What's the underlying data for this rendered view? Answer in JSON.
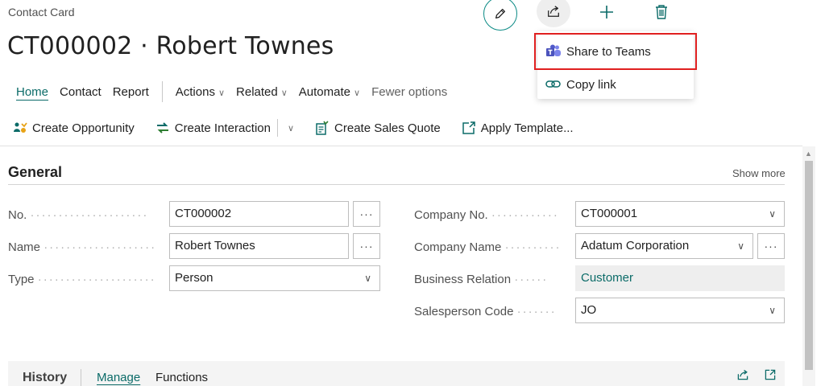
{
  "header": {
    "breadcrumb": "Contact Card",
    "title": "CT000002 · Robert Townes"
  },
  "share_menu": {
    "items": [
      {
        "label": "Share to Teams",
        "icon": "teams-icon"
      },
      {
        "label": "Copy link",
        "icon": "link-icon"
      }
    ]
  },
  "nav": {
    "tabs": [
      {
        "label": "Home",
        "active": true
      },
      {
        "label": "Contact"
      },
      {
        "label": "Report"
      }
    ],
    "menus": [
      {
        "label": "Actions"
      },
      {
        "label": "Related"
      },
      {
        "label": "Automate"
      }
    ],
    "fewer_label": "Fewer options"
  },
  "actions": {
    "create_opportunity": "Create Opportunity",
    "create_interaction": "Create Interaction",
    "create_sales_quote": "Create Sales Quote",
    "apply_template": "Apply Template..."
  },
  "general": {
    "title": "General",
    "show_more": "Show more",
    "left_fields": [
      {
        "label": "No.",
        "value": "CT000002"
      },
      {
        "label": "Name",
        "value": "Robert Townes"
      },
      {
        "label": "Type",
        "value": "Person"
      }
    ],
    "right_fields": [
      {
        "label": "Company No.",
        "value": "CT000001"
      },
      {
        "label": "Company Name",
        "value": "Adatum Corporation"
      },
      {
        "label": "Business Relation",
        "value": "Customer"
      },
      {
        "label": "Salesperson Code",
        "value": "JO"
      }
    ]
  },
  "history": {
    "title": "History",
    "tabs": [
      {
        "label": "Manage",
        "active": true
      },
      {
        "label": "Functions"
      }
    ]
  },
  "colors": {
    "accent": "#0b6b68",
    "highlight_border": "#e02020",
    "teams_purple": "#5059c9"
  }
}
